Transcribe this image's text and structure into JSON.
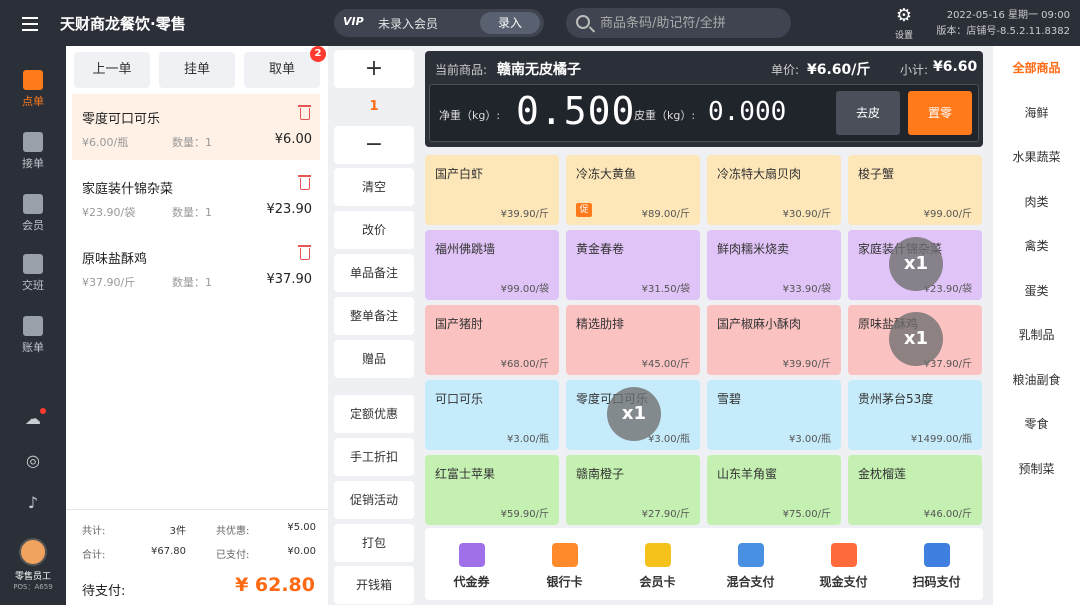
{
  "app": {
    "title": "天财商龙餐饮·零售",
    "vip_badge": "VIP",
    "member_prompt": "未录入会员",
    "member_button": "录入",
    "search_placeholder": "商品条码/助记符/全拼",
    "settings_label": "设置",
    "datetime": "2022-05-16 星期一 09:00",
    "version": "版本：店铺号-8.5.2.11.8382"
  },
  "nav": {
    "items": [
      {
        "label": "点单",
        "active": true
      },
      {
        "label": "接单",
        "active": false
      },
      {
        "label": "会员",
        "active": false
      },
      {
        "label": "交班",
        "active": false
      },
      {
        "label": "账单",
        "active": false
      }
    ],
    "icons": [
      "cloud-icon",
      "headset-icon",
      "bell-icon"
    ],
    "staff": {
      "name": "零售员工",
      "pos": "POS：A659"
    }
  },
  "order": {
    "tabs": [
      {
        "label": "上一单"
      },
      {
        "label": "挂单"
      },
      {
        "label": "取单",
        "badge": "2"
      }
    ],
    "items": [
      {
        "name": "零度可口可乐",
        "price": "¥6.00/瓶",
        "qty": "数量：1",
        "subtotal": "¥6.00",
        "selected": true
      },
      {
        "name": "家庭装什锦杂菜",
        "price": "¥23.90/袋",
        "qty": "数量：1",
        "subtotal": "¥23.90",
        "selected": false
      },
      {
        "name": "原味盐酥鸡",
        "price": "¥37.90/斤",
        "qty": "数量：1",
        "subtotal": "¥37.90",
        "selected": false
      }
    ],
    "summary": {
      "total_label": "共计:",
      "total_value": "3件",
      "discount_label": "共优惠:",
      "discount_value": "¥5.00",
      "sum_label": "合计:",
      "sum_value": "¥67.80",
      "paid_label": "已支付:",
      "paid_value": "¥0.00",
      "due_label": "待支付:",
      "due_value": "¥ 62.80"
    }
  },
  "functions": {
    "plus": "+",
    "qty": "1",
    "minus": "−",
    "buttons": [
      "清空",
      "改价",
      "单品备注",
      "整单备注",
      "赠品",
      "定额优惠",
      "手工折扣",
      "促销活动",
      "打包",
      "开钱箱"
    ]
  },
  "scale": {
    "current_label": "当前商品:",
    "current_value": "赣南无皮橘子",
    "unit_price_label": "单价:",
    "unit_price_value": "¥6.60/斤",
    "subtotal_label": "小计:",
    "subtotal_value": "¥6.60",
    "net_label": "净重（kg）:",
    "net_value": "0.500",
    "tare_label": "皮重（kg）:",
    "tare_value": "0.000",
    "tare_button": "去皮",
    "zero_button": "置零"
  },
  "products": [
    {
      "name": "国产白虾",
      "price": "¥39.90/斤",
      "color": "yellow"
    },
    {
      "name": "冷冻大黄鱼",
      "price": "¥89.00/斤",
      "color": "yellow",
      "promo": "促"
    },
    {
      "name": "冷冻特大扇贝肉",
      "price": "¥30.90/斤",
      "color": "yellow"
    },
    {
      "name": "梭子蟹",
      "price": "¥99.00/斤",
      "color": "yellow"
    },
    {
      "name": "福州佛跳墙",
      "price": "¥99.00/袋",
      "color": "purple"
    },
    {
      "name": "黄金春卷",
      "price": "¥31.50/袋",
      "color": "purple"
    },
    {
      "name": "鲜肉糯米烧卖",
      "price": "¥33.90/袋",
      "color": "purple"
    },
    {
      "name": "家庭装什锦杂菜",
      "price": "¥23.90/袋",
      "color": "purple",
      "qty": "x1"
    },
    {
      "name": "国产猪肘",
      "price": "¥68.00/斤",
      "color": "pink"
    },
    {
      "name": "精选肋排",
      "price": "¥45.00/斤",
      "color": "pink"
    },
    {
      "name": "国产椒麻小酥肉",
      "price": "¥39.90/斤",
      "color": "pink"
    },
    {
      "name": "原味盐酥鸡",
      "price": "¥37.90/斤",
      "color": "pink",
      "qty": "x1"
    },
    {
      "name": "可口可乐",
      "price": "¥3.00/瓶",
      "color": "cyan"
    },
    {
      "name": "零度可口可乐",
      "price": "¥3.00/瓶",
      "color": "cyan",
      "qty": "x1"
    },
    {
      "name": "雪碧",
      "price": "¥3.00/瓶",
      "color": "cyan"
    },
    {
      "name": "贵州茅台53度",
      "price": "¥1499.00/瓶",
      "color": "cyan"
    },
    {
      "name": "红富士苹果",
      "price": "¥59.90/斤",
      "color": "green"
    },
    {
      "name": "赣南橙子",
      "price": "¥27.90/斤",
      "color": "green"
    },
    {
      "name": "山东羊角蜜",
      "price": "¥75.00/斤",
      "color": "green"
    },
    {
      "name": "金枕榴莲",
      "price": "¥46.00/斤",
      "color": "green"
    }
  ],
  "payments": [
    {
      "label": "代金券",
      "icon": "voucher-icon",
      "color": "#a070e8"
    },
    {
      "label": "银行卡",
      "icon": "bank-card-icon",
      "color": "#ff8a2b"
    },
    {
      "label": "会员卡",
      "icon": "member-card-icon",
      "color": "#f5c21b"
    },
    {
      "label": "混合支付",
      "icon": "mixed-pay-icon",
      "color": "#4a90e2"
    },
    {
      "label": "现金支付",
      "icon": "cash-icon",
      "color": "#ff6a3d"
    },
    {
      "label": "扫码支付",
      "icon": "scan-icon",
      "color": "#3f7fe0"
    }
  ],
  "categories": [
    {
      "label": "全部商品",
      "active": true
    },
    {
      "label": "海鲜"
    },
    {
      "label": "水果蔬菜"
    },
    {
      "label": "肉类"
    },
    {
      "label": "禽类"
    },
    {
      "label": "蛋类"
    },
    {
      "label": "乳制品"
    },
    {
      "label": "粮油副食"
    },
    {
      "label": "零食"
    },
    {
      "label": "预制菜"
    }
  ]
}
